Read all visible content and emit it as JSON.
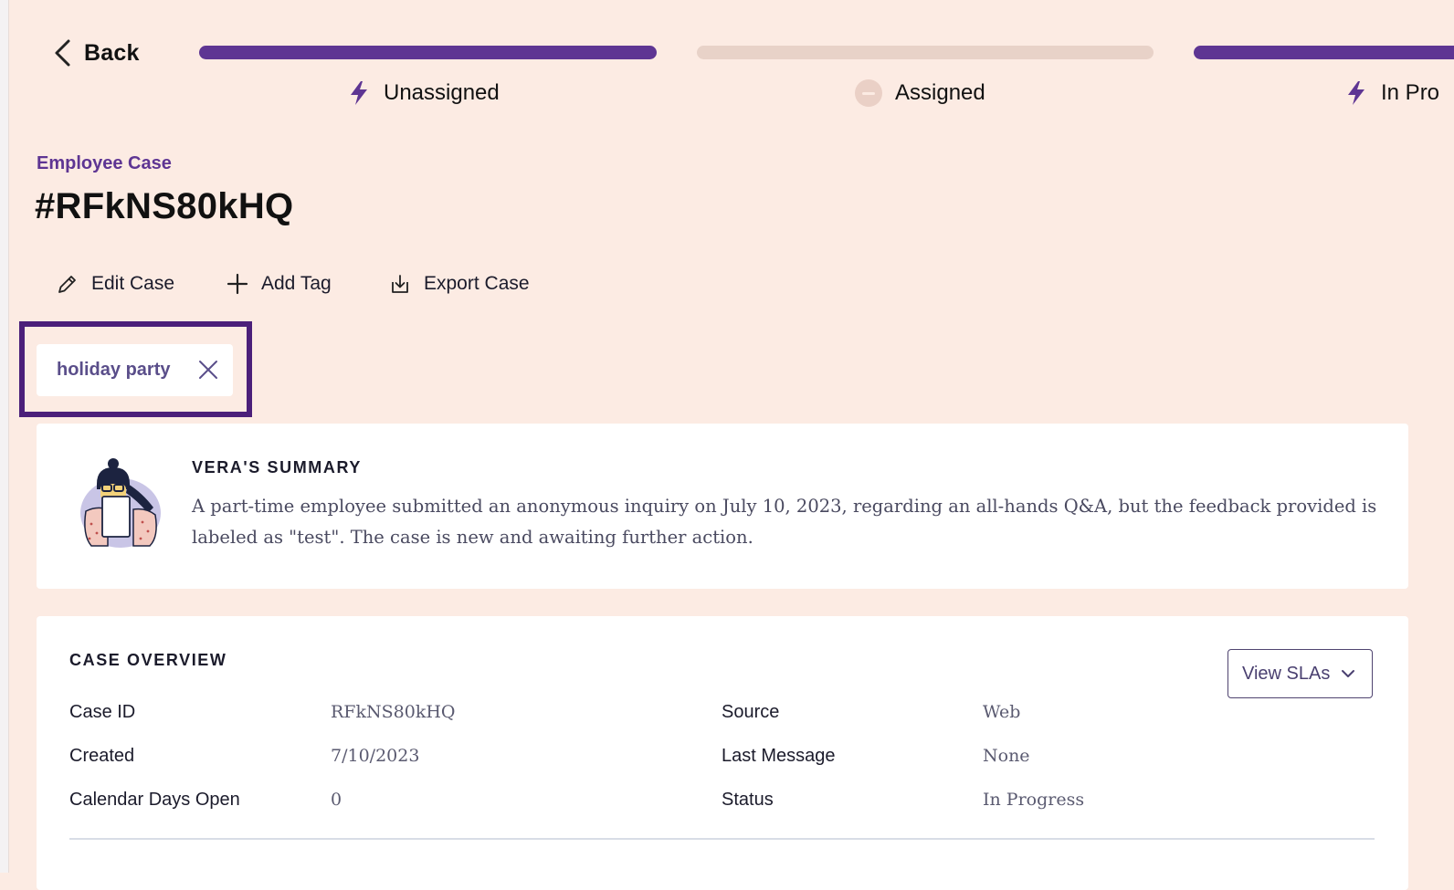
{
  "nav": {
    "back_label": "Back"
  },
  "stages": [
    {
      "label": "Unassigned",
      "icon": "bolt-icon",
      "active": true
    },
    {
      "label": "Assigned",
      "icon": "minus-circle-icon",
      "active": false
    },
    {
      "label": "In Pro",
      "icon": "bolt-icon",
      "active": true
    }
  ],
  "header": {
    "case_type": "Employee Case",
    "case_number": "#RFkNS80kHQ"
  },
  "actions": {
    "edit_label": "Edit Case",
    "add_tag_label": "Add Tag",
    "export_label": "Export Case"
  },
  "tags": [
    {
      "label": "holiday party"
    }
  ],
  "summary": {
    "heading": "VERA'S SUMMARY",
    "text": "A part-time employee submitted an anonymous inquiry on July 10, 2023, regarding an all-hands Q&A, but the feedback provided is labeled as \"test\". The case is new and awaiting further action."
  },
  "overview": {
    "heading": "CASE OVERVIEW",
    "sla_button_label": "View SLAs",
    "left_fields": [
      {
        "label": "Case ID",
        "value": "RFkNS80kHQ"
      },
      {
        "label": "Created",
        "value": "7/10/2023"
      },
      {
        "label": "Calendar Days Open",
        "value": "0"
      }
    ],
    "right_fields": [
      {
        "label": "Source",
        "value": "Web"
      },
      {
        "label": "Last Message",
        "value": "None"
      },
      {
        "label": "Status",
        "value": "In Progress"
      }
    ]
  },
  "colors": {
    "accent": "#5e3593",
    "background": "#fcebe3",
    "highlight_border": "#4b1f7a"
  }
}
